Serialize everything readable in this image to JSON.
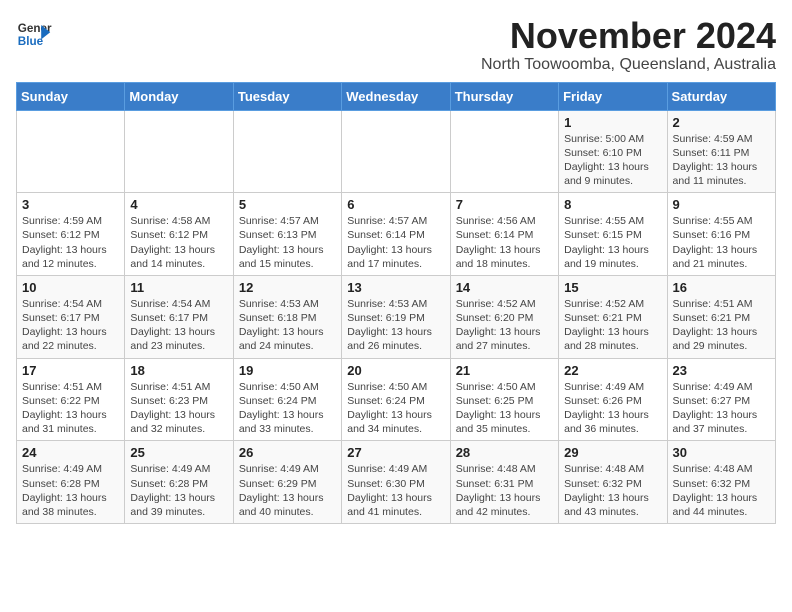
{
  "logo": {
    "general": "General",
    "blue": "Blue"
  },
  "title": "November 2024",
  "subtitle": "North Toowoomba, Queensland, Australia",
  "weekdays": [
    "Sunday",
    "Monday",
    "Tuesday",
    "Wednesday",
    "Thursday",
    "Friday",
    "Saturday"
  ],
  "weeks": [
    [
      {
        "day": "",
        "info": ""
      },
      {
        "day": "",
        "info": ""
      },
      {
        "day": "",
        "info": ""
      },
      {
        "day": "",
        "info": ""
      },
      {
        "day": "",
        "info": ""
      },
      {
        "day": "1",
        "info": "Sunrise: 5:00 AM\nSunset: 6:10 PM\nDaylight: 13 hours and 9 minutes."
      },
      {
        "day": "2",
        "info": "Sunrise: 4:59 AM\nSunset: 6:11 PM\nDaylight: 13 hours and 11 minutes."
      }
    ],
    [
      {
        "day": "3",
        "info": "Sunrise: 4:59 AM\nSunset: 6:12 PM\nDaylight: 13 hours and 12 minutes."
      },
      {
        "day": "4",
        "info": "Sunrise: 4:58 AM\nSunset: 6:12 PM\nDaylight: 13 hours and 14 minutes."
      },
      {
        "day": "5",
        "info": "Sunrise: 4:57 AM\nSunset: 6:13 PM\nDaylight: 13 hours and 15 minutes."
      },
      {
        "day": "6",
        "info": "Sunrise: 4:57 AM\nSunset: 6:14 PM\nDaylight: 13 hours and 17 minutes."
      },
      {
        "day": "7",
        "info": "Sunrise: 4:56 AM\nSunset: 6:14 PM\nDaylight: 13 hours and 18 minutes."
      },
      {
        "day": "8",
        "info": "Sunrise: 4:55 AM\nSunset: 6:15 PM\nDaylight: 13 hours and 19 minutes."
      },
      {
        "day": "9",
        "info": "Sunrise: 4:55 AM\nSunset: 6:16 PM\nDaylight: 13 hours and 21 minutes."
      }
    ],
    [
      {
        "day": "10",
        "info": "Sunrise: 4:54 AM\nSunset: 6:17 PM\nDaylight: 13 hours and 22 minutes."
      },
      {
        "day": "11",
        "info": "Sunrise: 4:54 AM\nSunset: 6:17 PM\nDaylight: 13 hours and 23 minutes."
      },
      {
        "day": "12",
        "info": "Sunrise: 4:53 AM\nSunset: 6:18 PM\nDaylight: 13 hours and 24 minutes."
      },
      {
        "day": "13",
        "info": "Sunrise: 4:53 AM\nSunset: 6:19 PM\nDaylight: 13 hours and 26 minutes."
      },
      {
        "day": "14",
        "info": "Sunrise: 4:52 AM\nSunset: 6:20 PM\nDaylight: 13 hours and 27 minutes."
      },
      {
        "day": "15",
        "info": "Sunrise: 4:52 AM\nSunset: 6:21 PM\nDaylight: 13 hours and 28 minutes."
      },
      {
        "day": "16",
        "info": "Sunrise: 4:51 AM\nSunset: 6:21 PM\nDaylight: 13 hours and 29 minutes."
      }
    ],
    [
      {
        "day": "17",
        "info": "Sunrise: 4:51 AM\nSunset: 6:22 PM\nDaylight: 13 hours and 31 minutes."
      },
      {
        "day": "18",
        "info": "Sunrise: 4:51 AM\nSunset: 6:23 PM\nDaylight: 13 hours and 32 minutes."
      },
      {
        "day": "19",
        "info": "Sunrise: 4:50 AM\nSunset: 6:24 PM\nDaylight: 13 hours and 33 minutes."
      },
      {
        "day": "20",
        "info": "Sunrise: 4:50 AM\nSunset: 6:24 PM\nDaylight: 13 hours and 34 minutes."
      },
      {
        "day": "21",
        "info": "Sunrise: 4:50 AM\nSunset: 6:25 PM\nDaylight: 13 hours and 35 minutes."
      },
      {
        "day": "22",
        "info": "Sunrise: 4:49 AM\nSunset: 6:26 PM\nDaylight: 13 hours and 36 minutes."
      },
      {
        "day": "23",
        "info": "Sunrise: 4:49 AM\nSunset: 6:27 PM\nDaylight: 13 hours and 37 minutes."
      }
    ],
    [
      {
        "day": "24",
        "info": "Sunrise: 4:49 AM\nSunset: 6:28 PM\nDaylight: 13 hours and 38 minutes."
      },
      {
        "day": "25",
        "info": "Sunrise: 4:49 AM\nSunset: 6:28 PM\nDaylight: 13 hours and 39 minutes."
      },
      {
        "day": "26",
        "info": "Sunrise: 4:49 AM\nSunset: 6:29 PM\nDaylight: 13 hours and 40 minutes."
      },
      {
        "day": "27",
        "info": "Sunrise: 4:49 AM\nSunset: 6:30 PM\nDaylight: 13 hours and 41 minutes."
      },
      {
        "day": "28",
        "info": "Sunrise: 4:48 AM\nSunset: 6:31 PM\nDaylight: 13 hours and 42 minutes."
      },
      {
        "day": "29",
        "info": "Sunrise: 4:48 AM\nSunset: 6:32 PM\nDaylight: 13 hours and 43 minutes."
      },
      {
        "day": "30",
        "info": "Sunrise: 4:48 AM\nSunset: 6:32 PM\nDaylight: 13 hours and 44 minutes."
      }
    ]
  ]
}
